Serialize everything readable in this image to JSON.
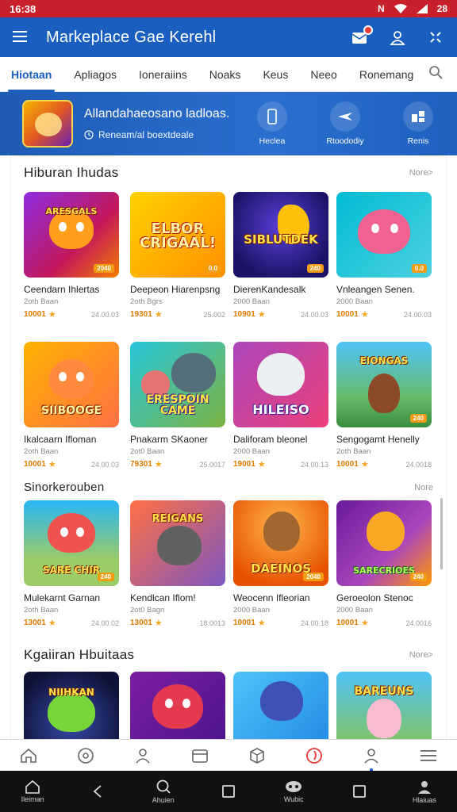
{
  "status_bar": {
    "time": "16:38",
    "battery": "28"
  },
  "app_bar": {
    "title": "Markeplace Gae Kerehl",
    "icons": [
      "menu-icon",
      "inbox-icon",
      "user-icon",
      "settings-icon"
    ]
  },
  "tabs": [
    {
      "label": "Hiotaan",
      "active": true
    },
    {
      "label": "Apliagos",
      "active": false
    },
    {
      "label": "Ioneraiins",
      "active": false
    },
    {
      "label": "Noaks",
      "active": false
    },
    {
      "label": "Keus",
      "active": false
    },
    {
      "label": "Neeo",
      "active": false
    },
    {
      "label": "Ronemang",
      "active": false
    }
  ],
  "banner": {
    "title": "Allandahaeosano ladloas.",
    "subtitle": "Reneam/al boextdeale",
    "buttons": [
      {
        "label": "Heclea",
        "icon": "phone-icon"
      },
      {
        "label": "Rtoododiy",
        "icon": "plane-icon"
      },
      {
        "label": "Renis",
        "icon": "grid-icon"
      }
    ]
  },
  "sections": [
    {
      "title": "Hiburan Ihudas",
      "more": "Nore>",
      "games": [
        {
          "name": "Ceendarn Ihlertas",
          "dev": "2oth Baan",
          "rating": "10001",
          "downloads": "24.00.03",
          "logo": "ARESGALS",
          "badge": "2040"
        },
        {
          "name": "Deepeon Hiarenpsng",
          "dev": "2oth Bgrs",
          "rating": "19301",
          "downloads": "25.002",
          "logo": "ELBOR CRIGAAL!",
          "badge": "0.0"
        },
        {
          "name": "DierenKandesalk",
          "dev": "2000 Baan",
          "rating": "10901",
          "downloads": "24.00.03",
          "logo": "SIBLUTDEK",
          "badge": "240"
        },
        {
          "name": "Vnleangen Senen.",
          "dev": "2000 Baan",
          "rating": "10001",
          "downloads": "24.00.03",
          "logo": "",
          "badge": "0.0"
        },
        {
          "name": "Ikalcaarn Ifloman",
          "dev": "2oth Baan",
          "rating": "10001",
          "downloads": "24.00.03",
          "logo": "SIIBOOGE",
          "badge": ""
        },
        {
          "name": "Pnakarm SKaoner",
          "dev": "2ot0 Baan",
          "rating": "79301",
          "downloads": "25.0017",
          "logo": "ERESPOIN CAME",
          "badge": ""
        },
        {
          "name": "Daliforam bleonel",
          "dev": "2000 Baan",
          "rating": "19001",
          "downloads": "24.00.13",
          "logo": "HILEISO",
          "badge": ""
        },
        {
          "name": "Sengogamt Henelly",
          "dev": "2oth Baan",
          "rating": "10001",
          "downloads": "24.0018",
          "logo": "EIONGAS",
          "badge": "240"
        }
      ]
    },
    {
      "title": "Sinorkerouben",
      "more": "Nore",
      "games": [
        {
          "name": "Mulekarnt Garnan",
          "dev": "2oth Baan",
          "rating": "13001",
          "downloads": "24.00.02",
          "logo": "SARE CHIR",
          "badge": "240"
        },
        {
          "name": "Kendlcan Iflom!",
          "dev": "2ot0 Bagn",
          "rating": "13001",
          "downloads": "18.0013",
          "logo": "REIGANS",
          "badge": ""
        },
        {
          "name": "Weocenn Ifleorian",
          "dev": "2000 Baan",
          "rating": "10001",
          "downloads": "24.00.18",
          "logo": "DAEINOS",
          "badge": "2040"
        },
        {
          "name": "Geroeolon Stenoc",
          "dev": "2000 Baan",
          "rating": "10001",
          "downloads": "24.0016",
          "logo": "SARECRIOES",
          "badge": "240"
        }
      ]
    },
    {
      "title": "Kgaiiran Hbuitaas",
      "more": "Nore>",
      "games": [
        {
          "name": "",
          "logo": "NIIHKAN"
        },
        {
          "name": "",
          "logo": ""
        },
        {
          "name": "",
          "logo": ""
        },
        {
          "name": "",
          "logo": "BAREUNS"
        }
      ]
    }
  ],
  "bottom_nav": [
    "home-icon",
    "compass-icon",
    "people-icon",
    "store-icon",
    "box-icon",
    "fire-icon",
    "profile-icon",
    "more-menu-icon"
  ],
  "system_nav": [
    {
      "label": "Ileiman",
      "icon": "home-icon"
    },
    {
      "label": "",
      "icon": "back-icon"
    },
    {
      "label": "Ahuien",
      "icon": "search-icon"
    },
    {
      "label": "",
      "icon": "square-icon"
    },
    {
      "label": "Wubic",
      "icon": "gamepad-icon"
    },
    {
      "label": "",
      "icon": "square-icon"
    },
    {
      "label": "Hlaiuas",
      "icon": "account-icon"
    }
  ]
}
